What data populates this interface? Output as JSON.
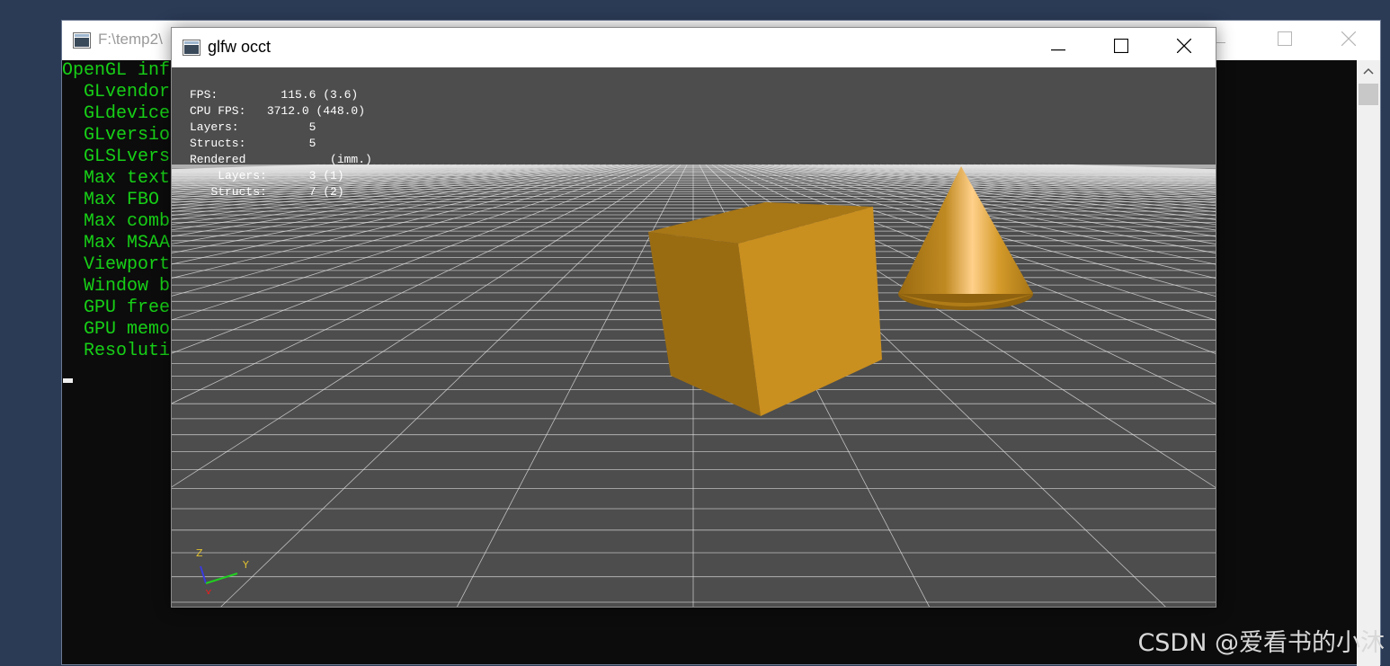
{
  "console_window": {
    "title": "F:\\temp2\\",
    "output_lines": [
      "OpenGL inf",
      "  GLvendor",
      "  GLdevice",
      "  GLversio",
      "  GLSLvers",
      "  Max text",
      "  Max FBO ",
      "  Max comb",
      "  Max MSAA",
      "  Viewport",
      "  Window b",
      "  GPU free",
      "  GPU memo",
      "  Resoluti"
    ],
    "text_color": "#17d017"
  },
  "glfw_window": {
    "title": "glfw occt",
    "stats_lines": [
      "FPS:         115.6 (3.6)",
      "CPU FPS:   3712.0 (448.0)",
      "Layers:          5",
      "Structs:         5",
      "Rendered            (imm.)",
      "    Layers:      3 (1)",
      "   Structs:      7 (2)"
    ],
    "axis_labels": {
      "z": "Z",
      "y": "Y",
      "x": "X"
    },
    "colors": {
      "background": "#4d4d4d",
      "grid": "#e6e6e6",
      "shape": "#c8901e"
    },
    "shapes": [
      "box",
      "cone"
    ]
  },
  "window_buttons": {
    "minimize": "minimize-icon",
    "maximize": "maximize-icon",
    "close": "close-icon"
  },
  "watermark": "CSDN @爱看书的小沐"
}
